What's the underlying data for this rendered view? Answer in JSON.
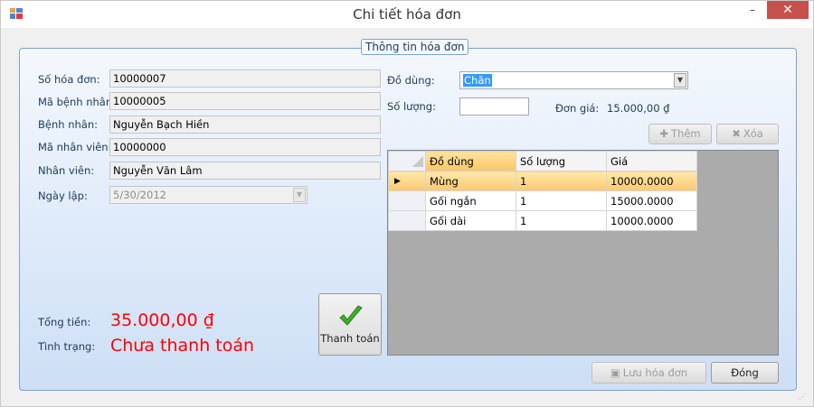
{
  "window": {
    "title": "Chi tiết hóa đơn",
    "minimize_symbol": "–",
    "maximize_symbol": "□",
    "close_symbol": "✕"
  },
  "group": {
    "legend": "Thông tin hóa đơn"
  },
  "invoice": {
    "invoice_no_label": "Số hóa đơn:",
    "invoice_no": "10000007",
    "patient_id_label": "Mã bệnh nhân:",
    "patient_id": "10000005",
    "patient_label": "Bệnh nhân:",
    "patient": "Nguyễn Bạch Hiền",
    "employee_id_label": "Mã nhân viên:",
    "employee_id": "10000000",
    "employee_label": "Nhân viên:",
    "employee": "Nguyễn Văn Lâm",
    "date_label": "Ngày lập:",
    "date": "5/30/2012"
  },
  "item_form": {
    "item_label": "Đồ dùng:",
    "item_value": "Chăn",
    "quantity_label": "Số lượng:",
    "quantity_value": "",
    "unit_price_label": "Đơn giá:",
    "unit_price": "15.000,00 ₫",
    "add_label": "Thêm",
    "delete_label": "Xóa"
  },
  "grid": {
    "columns": [
      "Đồ dùng",
      "Số lượng",
      "Giá"
    ],
    "rows": [
      {
        "item": "Mùng",
        "quantity": "1",
        "price": "10000.0000"
      },
      {
        "item": "Gối ngắn",
        "quantity": "1",
        "price": "15000.0000"
      },
      {
        "item": "Gối dài",
        "quantity": "1",
        "price": "10000.0000"
      }
    ]
  },
  "summary": {
    "total_label": "Tổng tiền:",
    "total": "35.000,00 ₫",
    "status_label": "Tình trạng:",
    "status": "Chưa thanh toán",
    "pay_label": "Thanh toán"
  },
  "actions": {
    "save_label": "Lưu hóa đơn",
    "close_label": "Đóng"
  },
  "colors": {
    "accent_red": "#ff0000",
    "selection_orange": "#fcc96b",
    "close_button": "#c7504c"
  }
}
